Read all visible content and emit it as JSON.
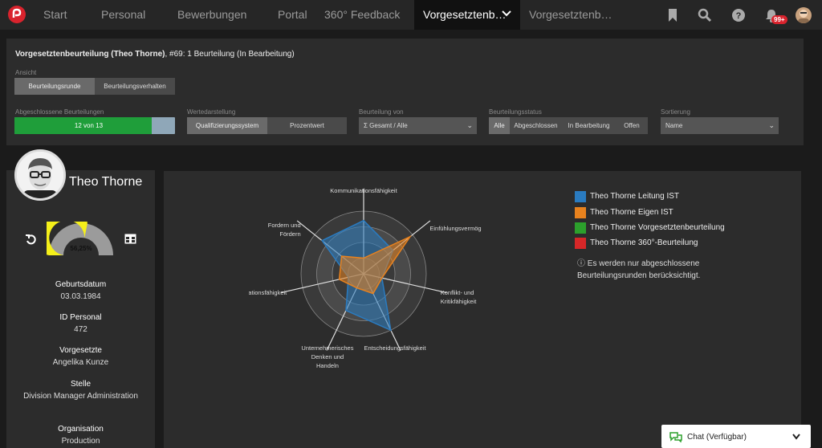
{
  "nav": {
    "items": [
      "Start",
      "Personal",
      "Bewerbungen",
      "Portal",
      "360° Feedback",
      "Vorgesetztenb…",
      "Vorgesetztenb…"
    ],
    "badge": "99+"
  },
  "header": {
    "title_bold": "Vorgesetztenbeurteilung (Theo Thorne)",
    "title_rest": ", #69: 1 Beurteilung (In Bearbeitung)"
  },
  "filters": {
    "ansicht_label": "Ansicht",
    "ansicht_options": [
      "Beurteilungsrunde",
      "Beurteilungsverhalten"
    ],
    "abgeschlossen_label": "Abgeschlossene Beurteilungen",
    "abgeschlossen_value": "12 von 13",
    "abgeschlossen_fraction": 0.923,
    "wertedarstellung_label": "Wertedarstellung",
    "wertedarstellung_options": [
      "Qualifizierungssystem",
      "Prozentwert"
    ],
    "beurteilung_von_label": "Beurteilung von",
    "beurteilung_von_value": "Gesamt / Alle",
    "status_label": "Beurteilungsstatus",
    "status_options": [
      "Alle",
      "Abgeschlossen",
      "In Bearbeitung",
      "Offen"
    ],
    "sortierung_label": "Sortierung",
    "sortierung_value": "Name"
  },
  "profile": {
    "name": "Theo Thorne",
    "gauge_value": "56,25%",
    "gauge_fraction": 0.5625,
    "fields": [
      {
        "label": "Geburtsdatum",
        "value": "03.03.1984"
      },
      {
        "label": "ID Personal",
        "value": "472"
      },
      {
        "label": "Vorgesetzte",
        "value": "Angelika Kunze"
      },
      {
        "label": "Stelle",
        "value": "Division Manager Administration"
      },
      {
        "label": "Organisation",
        "value": "Production"
      }
    ]
  },
  "chart_data": {
    "type": "radar",
    "axes": [
      "Kontakt- und Kommunikationsfähigkeit",
      "Einfühlungsvermögen",
      "Konflikt- und Kritikfähigkeit",
      "Entscheidungsfähigkeit",
      "Unternehmerisches Denken und Handeln",
      "Motivationsfähigkeit",
      "Fordern und Fördern"
    ],
    "series": [
      {
        "name": "Theo Thorne Leitung IST",
        "color": "#2a7bc0",
        "values": [
          0.85,
          0.6,
          0.3,
          1.0,
          0.65,
          0.25,
          0.85
        ]
      },
      {
        "name": "Theo Thorne Eigen IST",
        "color": "#e8821e",
        "values": [
          0.25,
          0.95,
          0.3,
          0.35,
          0.25,
          0.4,
          0.45
        ]
      },
      {
        "name": "Theo Thorne Vorgesetztenbeurteilung",
        "color": "#2ca02c",
        "values": [
          0,
          0,
          0,
          0,
          0,
          0,
          0
        ]
      },
      {
        "name": "Theo Thorne 360°-Beurteilung",
        "color": "#d62728",
        "values": [
          0,
          0,
          0,
          0,
          0,
          0,
          0
        ]
      }
    ]
  },
  "legend_note": "Es werden nur abgeschlossene Beurteilungsrunden berücksichtigt.",
  "chat_label": "Chat (Verfügbar)"
}
